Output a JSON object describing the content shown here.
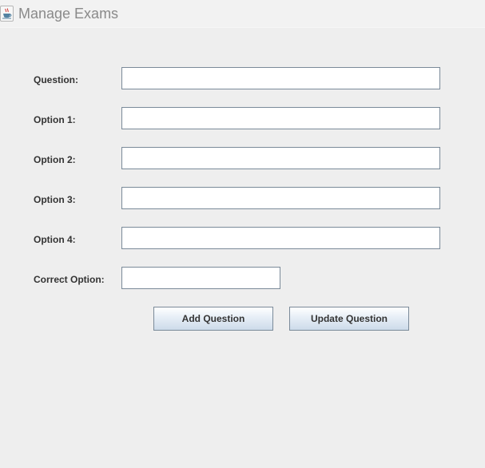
{
  "window": {
    "title": "Manage Exams",
    "icon": "java-coffee-cup-icon"
  },
  "form": {
    "fields": [
      {
        "label": "Question:",
        "value": ""
      },
      {
        "label": "Option 1:",
        "value": ""
      },
      {
        "label": "Option 2:",
        "value": ""
      },
      {
        "label": "Option 3:",
        "value": ""
      },
      {
        "label": "Option 4:",
        "value": ""
      },
      {
        "label": "Correct Option:",
        "value": ""
      }
    ]
  },
  "buttons": {
    "add_label": "Add Question",
    "update_label": "Update Question"
  },
  "colors": {
    "background": "#eeeeee",
    "field_border": "#7a8a99",
    "label_text": "#333333",
    "title_text": "#8a8a8a"
  }
}
